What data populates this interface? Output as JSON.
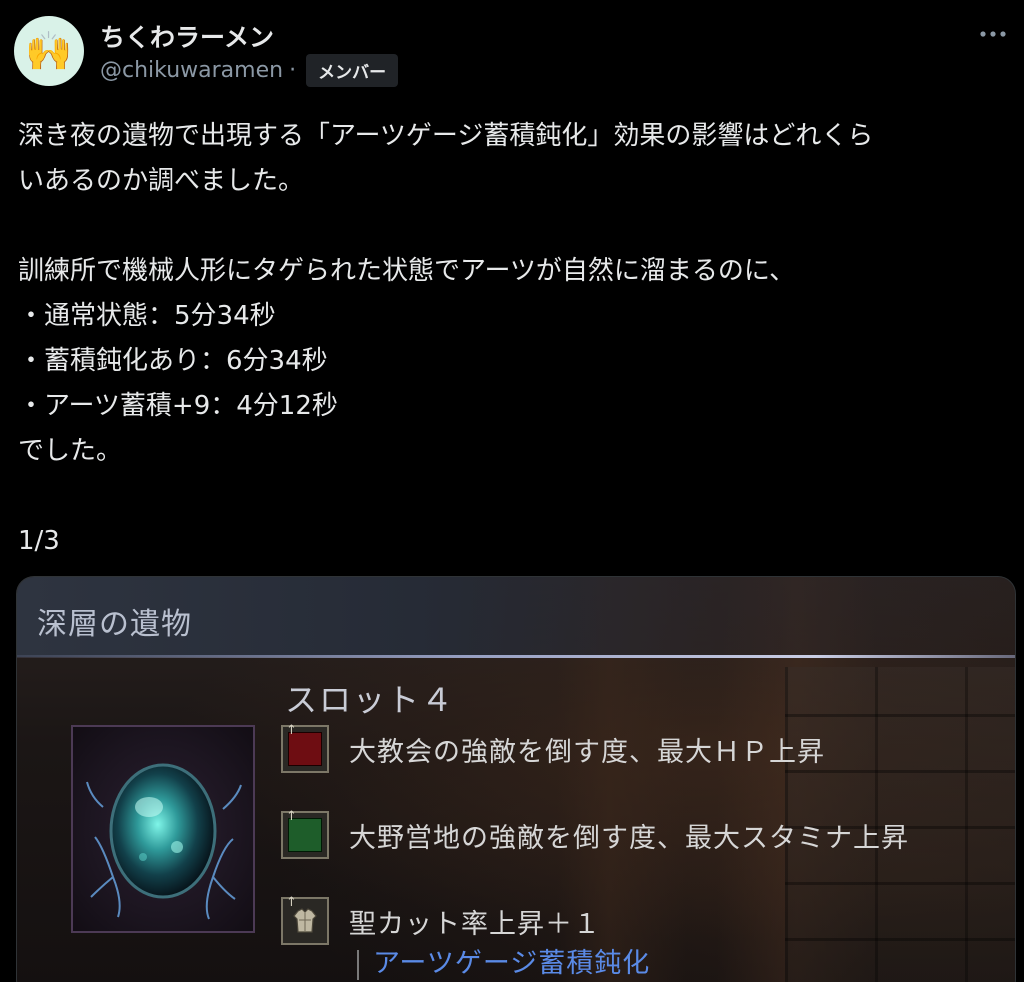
{
  "author": {
    "display_name": "ちくわラーメン",
    "handle": "@chikuwaramen",
    "separator": "·",
    "badge": "メンバー",
    "avatar_emoji": "🙌"
  },
  "menu_icon": "more-horizontal-icon",
  "post": {
    "lines": [
      "深き夜の遺物で出現する「アーツゲージ蓄積鈍化」効果の影響はどれくら",
      "いあるのか調べました。",
      "",
      "訓練所で機械人形にタゲられた状態でアーツが自然に溜まるのに、",
      "・通常状態：5分34秒",
      "・蓄積鈍化あり：6分34秒",
      "・アーツ蓄積+9：4分12秒",
      "でした。",
      "",
      "1/3"
    ]
  },
  "media": {
    "relic_title": "深層の遺物",
    "slot_title": "スロット４",
    "effects": [
      {
        "label": "大教会の強敵を倒す度、最大ＨＰ上昇",
        "icon": "red-square-icon",
        "color": "#6e0d12"
      },
      {
        "label": "大野営地の強敵を倒す度、最大スタミナ上昇",
        "icon": "green-square-icon",
        "color": "#1e5d2a"
      },
      {
        "label": "聖カット率上昇＋１",
        "icon": "armor-icon"
      }
    ],
    "sub_effect": "アーツゲージ蓄積鈍化",
    "sub_effect_color": "#5a8ae6"
  },
  "colors": {
    "background": "#000000",
    "text": "#e7e9ea",
    "secondary_text": "#8b98a5"
  }
}
